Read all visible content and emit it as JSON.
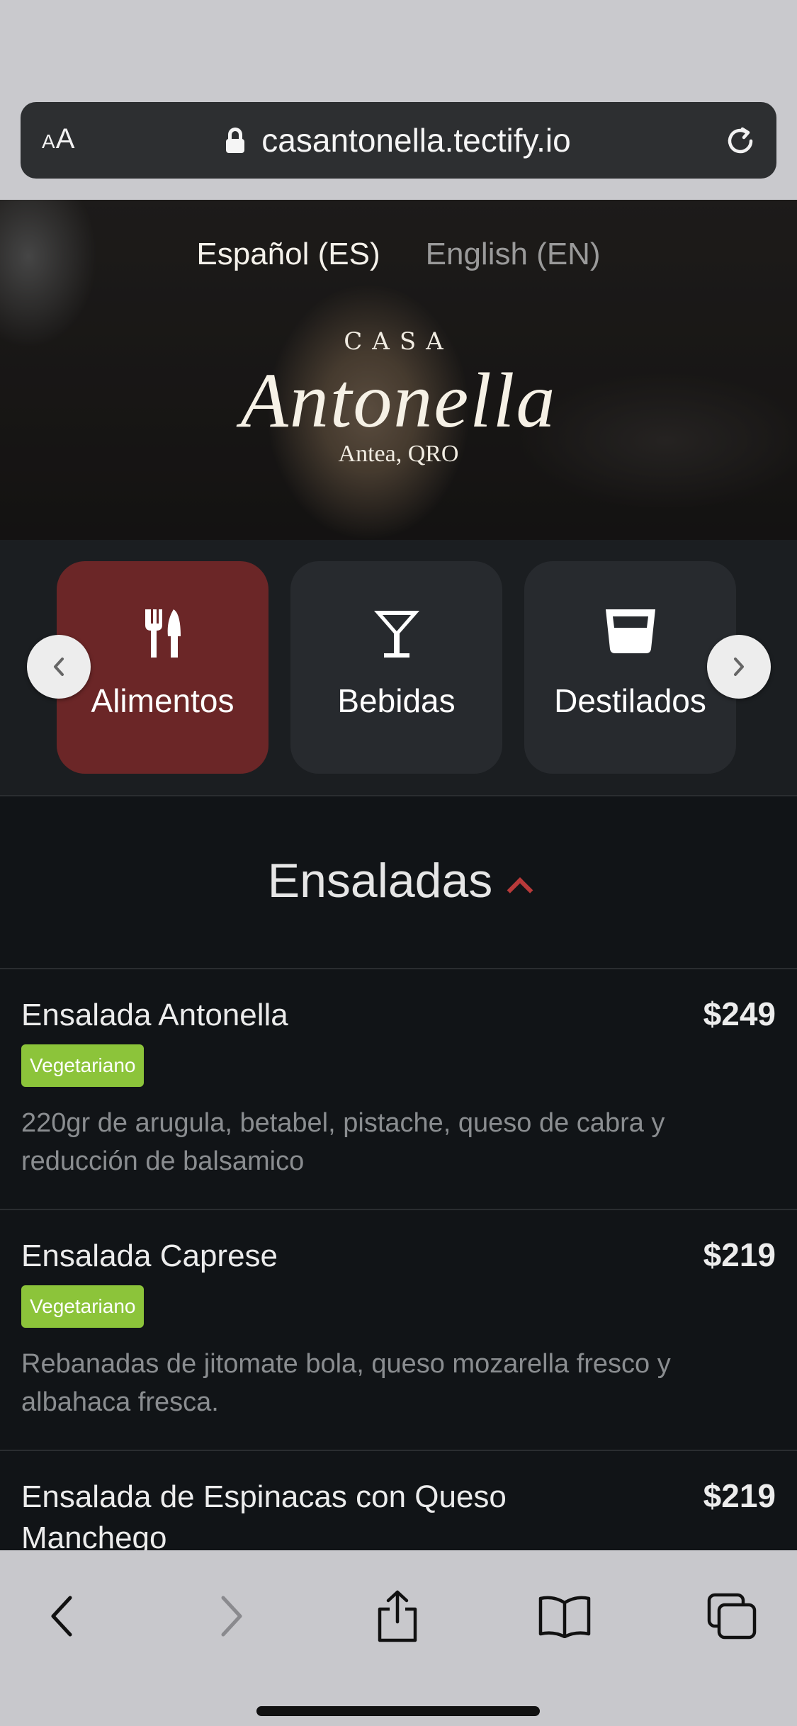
{
  "browser": {
    "text_size_label": "AA",
    "url": "casantonella.tectify.io"
  },
  "hero": {
    "languages": [
      "Español (ES)",
      "English (EN)"
    ],
    "brand_prefix": "CASA",
    "brand_name": "Antonella",
    "location": "Antea, QRO"
  },
  "categories": [
    {
      "label": "Alimentos",
      "icon": "utensils-icon",
      "active": true
    },
    {
      "label": "Bebidas",
      "icon": "cocktail-icon",
      "active": false
    },
    {
      "label": "Destilados",
      "icon": "glass-icon",
      "active": false
    }
  ],
  "colors": {
    "active_category": "#6b2627",
    "badge": "#8cc43a",
    "caret": "#b83a3a",
    "background": "#111417"
  },
  "section": {
    "title": "Ensaladas"
  },
  "items": [
    {
      "name": "Ensalada Antonella",
      "price": "$249",
      "badge": "Vegetariano",
      "description": "220gr de arugula, betabel, pistache, queso de cabra y reducción de balsamico"
    },
    {
      "name": "Ensalada Caprese",
      "price": "$219",
      "badge": "Vegetariano",
      "description": "Rebanadas de jitomate bola, queso mozarella fresco y albahaca fresca."
    },
    {
      "name": "Ensalada de Espinacas con Queso Manchego",
      "price": "$219"
    }
  ]
}
